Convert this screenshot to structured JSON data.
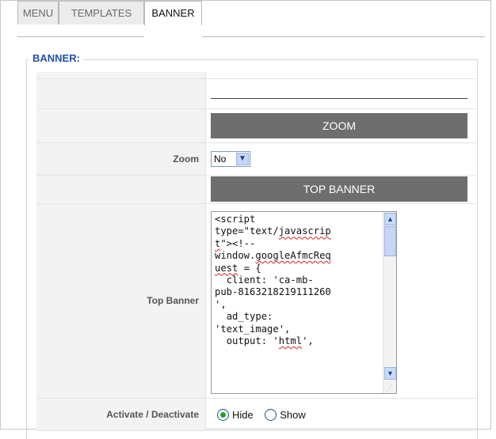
{
  "tabs": [
    "MENU",
    "TEMPLATES",
    "BANNER"
  ],
  "active_tab": "BANNER",
  "section_title": "BANNER:",
  "zoom_header": "ZOOM",
  "zoom_label": "Zoom",
  "zoom_value": "No",
  "top_banner_header": "TOP BANNER",
  "top_banner_label": "Top Banner",
  "top_banner_code": "<script\ntype=\"text/javascrip\nt\"><!--\nwindow.googleAfmcReq\nuest = {\n  client: 'ca-mb-\npub-8163218219111260\n',\n  ad_type:\n'text_image',\n  output: 'html',",
  "activate_label": "Activate / Deactivate",
  "radio_options": [
    "Hide",
    "Show"
  ],
  "radio_selected": "Hide"
}
